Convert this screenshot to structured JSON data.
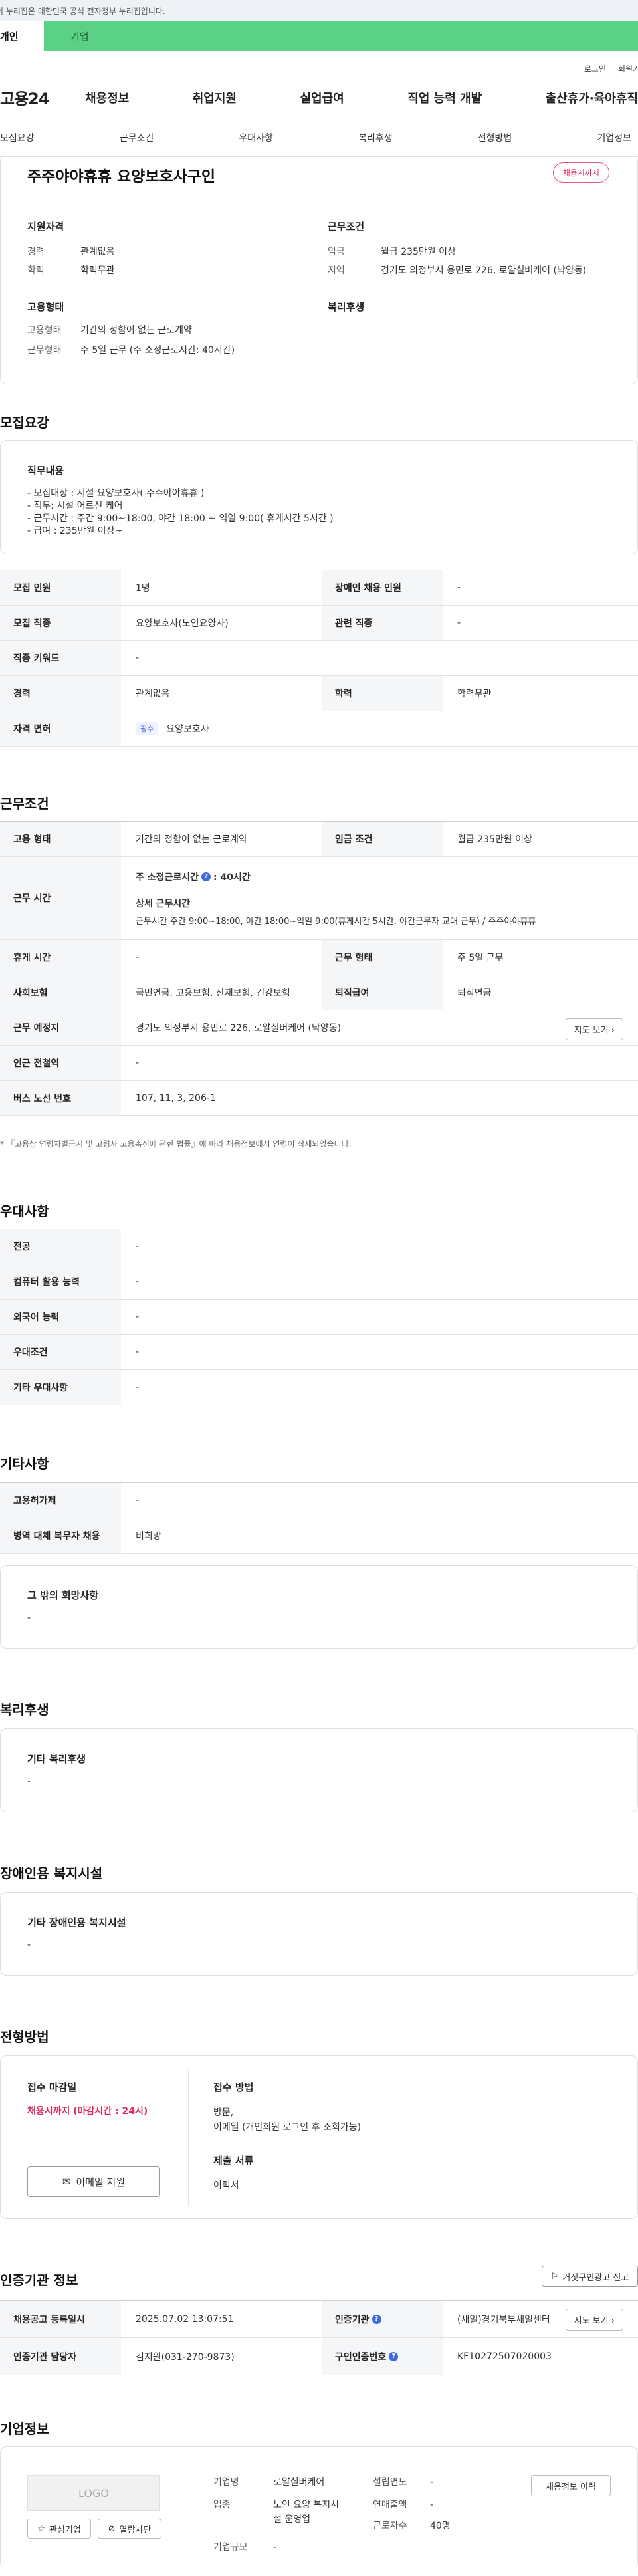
{
  "banner": {
    "text": "이 누리집은 대한민국 공식 전자정부 누리집입니다."
  },
  "user_tabs": {
    "personal": "개인",
    "corporate": "기업"
  },
  "util": {
    "login": "로그인",
    "signup": "회원가입"
  },
  "gnb": {
    "logo": "고용24",
    "menu": [
      "채용정보",
      "취업지원",
      "실업급여",
      "직업 능력 개발",
      "출산휴가·육아휴직"
    ]
  },
  "snb": [
    "모집요강",
    "근무조건",
    "우대사항",
    "복리후생",
    "전형방법",
    "기업정보"
  ],
  "summary": {
    "title": "주주야야휴휴 요양보호사구인",
    "badge": "채용시까지",
    "qual_title": "지원자격",
    "qual": [
      {
        "k": "경력",
        "v": "관계없음"
      },
      {
        "k": "학력",
        "v": "학력무관"
      }
    ],
    "emp_title": "고용형태",
    "emp": [
      {
        "k": "고용형태",
        "v": "기간의 정함이 없는 근로계약"
      },
      {
        "k": "근무형태",
        "v": "주 5일 근무 (주 소정근로시간: 40시간)"
      }
    ],
    "work_title": "근무조건",
    "work": [
      {
        "k": "임금",
        "v": "월급 235만원 이상"
      },
      {
        "k": "지역",
        "v": "경기도 의정부시 용민로 226, 로얄실버케어 (낙양동)"
      }
    ],
    "welfare_title": "복리후생"
  },
  "recruit": {
    "section_title": "모집요강",
    "duty_title": "직무내용",
    "duty_lines": [
      "- 모집대상 : 시설 요양보호사( 주주야야휴휴 )",
      "- 직무: 시설 어르신 케어",
      "- 근무시간 : 주간 9:00~18:00, 야간 18:00 ~ 익일 9:00( 휴게시간 5시간 )",
      "- 급여 : 235만원 이상~"
    ],
    "table": {
      "r1": {
        "k1": "모집 인원",
        "v1": "1명",
        "k2": "장애인 채용 인원",
        "v2": "-"
      },
      "r2": {
        "k1": "모집 직종",
        "v1": "요양보호사(노인요양사)",
        "k2": "관련 직종",
        "v2": "-"
      },
      "r3": {
        "k1": "직종 키워드",
        "v1": "-"
      },
      "r4": {
        "k1": "경력",
        "v1": "관계없음",
        "k2": "학력",
        "v2": "학력무관"
      },
      "r5": {
        "k1": "자격 면허",
        "chip": "필수",
        "v1": "요양보호사"
      }
    }
  },
  "work_cond": {
    "section_title": "근무조건",
    "r1": {
      "k1": "고용 형태",
      "v1": "기간의 정함이 없는 근로계약",
      "k2": "임금 조건",
      "v2": "월급 235만원 이상"
    },
    "r2": {
      "k1": "근무 시간",
      "hours_label": "주 소정근로시간",
      "hours_value": ": 40시간",
      "detail_title": "상세 근무시간",
      "detail": "근무시간 주간 9:00~18:00, 야간 18:00~익일 9:00(휴게시간 5시간, 야간근무자 교대 근무) / 주주야야휴휴"
    },
    "r3": {
      "k1": "휴게 시간",
      "v1": "-",
      "k2": "근무 형태",
      "v2": "주 5일 근무"
    },
    "r4": {
      "k1": "사회보험",
      "v1": "국민연금, 고용보험, 산재보험, 건강보험",
      "k2": "퇴직급여",
      "v2": "퇴직연금"
    },
    "r5": {
      "k1": "근무 예정지",
      "v1": "경기도 의정부시 용민로 226, 로얄실버케어 (낙양동)",
      "btn": "지도 보기"
    },
    "r6": {
      "k1": "인근 전철역",
      "v1": "-"
    },
    "r7": {
      "k1": "버스 노선 번호",
      "v1": "107, 11, 3, 206-1"
    },
    "note": "* 『고용상 연령차별금지 및 고령자 고용촉진에 관한 법률』에 따라 채용정보에서 연령이 삭제되었습니다."
  },
  "pref": {
    "section_title": "우대사항",
    "rows": [
      {
        "k": "전공",
        "v": "-"
      },
      {
        "k": "컴퓨터 활용 능력",
        "v": "-"
      },
      {
        "k": "외국어 능력",
        "v": "-"
      },
      {
        "k": "우대조건",
        "v": "-"
      },
      {
        "k": "기타 우대사항",
        "v": "-"
      }
    ]
  },
  "etc": {
    "section_title": "기타사항",
    "rows": [
      {
        "k": "고용허가제",
        "v": "-"
      },
      {
        "k": "병역 대체 복무자 채용",
        "v": "비희망"
      }
    ],
    "hope_title": "그 밖의 희망사항",
    "hope_value": "-"
  },
  "welfare": {
    "section_title": "복리후생",
    "box_title": "기타 복리후생",
    "box_value": "-"
  },
  "disabled": {
    "section_title": "장애인용 복지시설",
    "box_title": "기타 장애인용 복지시설",
    "box_value": "-"
  },
  "screening": {
    "section_title": "전형방법",
    "deadline_title": "접수 마감일",
    "deadline_value": "채용시까지 (마감시간 : 24시)",
    "email_btn": "이메일 지원",
    "method_title": "접수 방법",
    "method_lines": [
      "방문,",
      "이메일 (개인회원 로그인 후 조회가능)"
    ],
    "docs_title": "제출 서류",
    "docs_value": "이력서"
  },
  "cert": {
    "section_title": "인증기관 정보",
    "report_btn": "거짓구인광고 신고",
    "r1": {
      "k1": "채용공고 등록일시",
      "v1": "2025.07.02 13:07:51",
      "k2": "인증기관",
      "v2": "(새일)경기북부새일센터",
      "btn": "지도 보기"
    },
    "r2": {
      "k1": "인증기관 담당자",
      "v1": "김지원(031-270-9873)",
      "k2": "구인인증번호",
      "v2": "KF10272507020003"
    }
  },
  "company": {
    "section_title": "기업정보",
    "logo": "LOGO",
    "interest_btn": "관심기업",
    "block_btn": "열람차단",
    "history_btn": "채용정보 이력",
    "rows_left": [
      {
        "k": "기업명",
        "v": "로얄실버케어"
      },
      {
        "k": "업종",
        "v": "노인 요양 복지시설 운영업"
      },
      {
        "k": "기업규모",
        "v": "-"
      }
    ],
    "rows_right": [
      {
        "k": "설립연도",
        "v": "-"
      },
      {
        "k": "연매출액",
        "v": "-"
      },
      {
        "k": "근로자수",
        "v": "40명"
      }
    ]
  }
}
